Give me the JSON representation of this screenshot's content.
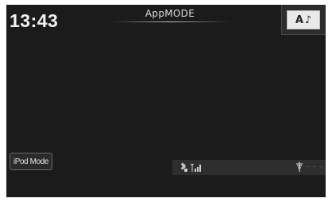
{
  "header": {
    "clock": "13:43",
    "mode_title": "AppMODE",
    "source_button": {
      "letter": "A",
      "note": "♪",
      "icon": "audio-source-icon"
    }
  },
  "footer": {
    "ipod_mode_label": "iPod Mode",
    "status": {
      "bluetooth_icon": "bluetooth-phone-icon",
      "signal_icon": "signal-strength-icon",
      "network_icon": "network-antenna-icon",
      "network_placeholder": "– – –"
    }
  },
  "colors": {
    "background": "#1b1b1b",
    "text": "#f2f2f2",
    "status_bar": "#2e2e2e"
  }
}
